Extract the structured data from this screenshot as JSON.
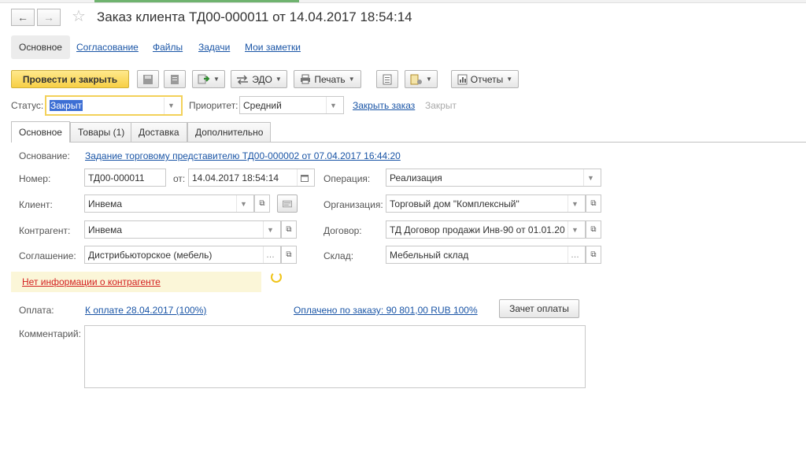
{
  "window": {
    "title": "Заказ клиента ТД00-000011 от 14.04.2017 18:54:14"
  },
  "topnav": [
    {
      "label": "Основное",
      "active": true
    },
    {
      "label": "Согласование"
    },
    {
      "label": "Файлы"
    },
    {
      "label": "Задачи"
    },
    {
      "label": "Мои заметки"
    }
  ],
  "toolbar": {
    "post_close_label": "Провести и закрыть",
    "edo_label": "ЭДО",
    "print_label": "Печать",
    "reports_label": "Отчеты"
  },
  "status_row": {
    "status_label": "Статус:",
    "status_value": "Закрыт",
    "priority_label": "Приоритет:",
    "priority_value": "Средний",
    "close_order_link": "Закрыть заказ",
    "closed_text": "Закрыт"
  },
  "tabs": [
    {
      "label": "Основное"
    },
    {
      "label": "Товары (1)"
    },
    {
      "label": "Доставка"
    },
    {
      "label": "Дополнительно"
    }
  ],
  "form": {
    "basis_label": "Основание:",
    "basis_link": "Задание торговому представителю ТД00-000002 от 07.04.2017 16:44:20",
    "number_label": "Номер:",
    "number_value": "ТД00-000011",
    "from_label": "от:",
    "date_value": "14.04.2017 18:54:14",
    "operation_label": "Операция:",
    "operation_value": "Реализация",
    "client_label": "Клиент:",
    "client_value": "Инвема",
    "organization_label": "Организация:",
    "organization_value": "Торговый дом \"Комплексный\"",
    "counterparty_label": "Контрагент:",
    "counterparty_value": "Инвема",
    "contract_label": "Договор:",
    "contract_value": "ТД Договор продажи Инв-90 от 01.01.20",
    "agreement_label": "Соглашение:",
    "agreement_value": "Дистрибьюторское (мебель)",
    "warehouse_label": "Склад:",
    "warehouse_value": "Мебельный склад",
    "warning_text": "Нет информации о контрагенте",
    "payment_label": "Оплата:",
    "payment_link": "К оплате 28.04.2017 (100%)",
    "paid_link": "Оплачено по заказу: 90 801,00 RUB 100%",
    "offset_button": "Зачет оплаты",
    "comment_label": "Комментарий:",
    "comment_value": ""
  },
  "colors": {
    "link": "#1a55a6",
    "primary_button": "#f7cf45",
    "warning_bg": "#fbf6d8",
    "warning_text": "#d32020",
    "focus_border": "#f3d15a"
  }
}
